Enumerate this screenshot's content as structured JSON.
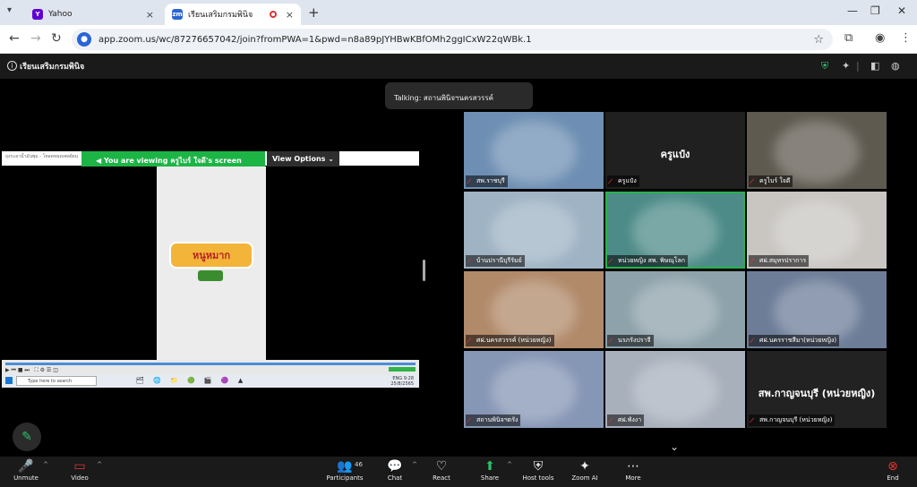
{
  "browser": {
    "tabs": [
      {
        "title": "Yahoo",
        "favicon": "Y",
        "color": "#6001d2"
      },
      {
        "title": "เรียนเสริมกรมพินิจ",
        "favicon": "zm",
        "color": "#2a64d6"
      }
    ],
    "url": "app.zoom.us/wc/87276657042/join?fromPWA=1&pwd=n8a89pJYHBwKBfOMh2ggICxW22qWBk.1"
  },
  "meeting": {
    "title": "เรียนเสริมกรมพินิจ",
    "talking": "Talking: สถานพินิจฯนครสวรรค์"
  },
  "share": {
    "viewing": "You are viewing  ครูไบร์ ใจดี's screen",
    "view_options": "View Options",
    "strip_text": "ถุงกะลาน้ำมันพุม - โหลดหมดเพลย์ผน",
    "logo_text": "หนูหมาก",
    "search_placeholder": "Type here to search",
    "apps": "🗂 🌐 📁 🟢 🎬 🟣 ▲",
    "tray_time": "9:28",
    "tray_date": "25/8/2565",
    "tray_lang": "ENG"
  },
  "gallery": [
    {
      "name": "สพ.ราชบุรี",
      "bg": "#6e8fb3"
    },
    {
      "name": "ครูแป๋ง",
      "bg": "#202020",
      "big": "ครูแป๋ง"
    },
    {
      "name": "ครูไบร์ ใจดี",
      "bg": "#5f5a50"
    },
    {
      "name": "บ้านปรานีบุรีรัมย์",
      "bg": "#9fb3c4"
    },
    {
      "name": "หน่วยหญิง สพ. พิษณุโลก",
      "bg": "#4d8b88",
      "active": true
    },
    {
      "name": "ศฝ.สมุทรปราการ",
      "bg": "#c9c6c2"
    },
    {
      "name": "ศฝ.นครสวรรค์ (หน่วยหญิง)",
      "bg": "#b18a6a"
    },
    {
      "name": "นรภรังปราจี",
      "bg": "#8ea2ab"
    },
    {
      "name": "ศฝ.นครราชสีมา(หน่วยหญิง)",
      "bg": "#6d7d98"
    },
    {
      "name": "สถานพินิจฯตรัง",
      "bg": "#8696b5"
    },
    {
      "name": "ศฝ.พังงา",
      "bg": "#a8b0bc"
    },
    {
      "name": "สพ.กาญจนบุรี (หน่วยหญิง)",
      "bg": "#222222",
      "big": "สพ.กาญจนบุรี (หน่วยหญิง)"
    }
  ],
  "toolbar": {
    "unmute": "Unmute",
    "video": "Video",
    "participants": "Participants",
    "participants_count": "46",
    "chat": "Chat",
    "react": "React",
    "share": "Share",
    "host_tools": "Host tools",
    "zoom_ai": "Zoom AI",
    "more": "More",
    "end": "End"
  }
}
